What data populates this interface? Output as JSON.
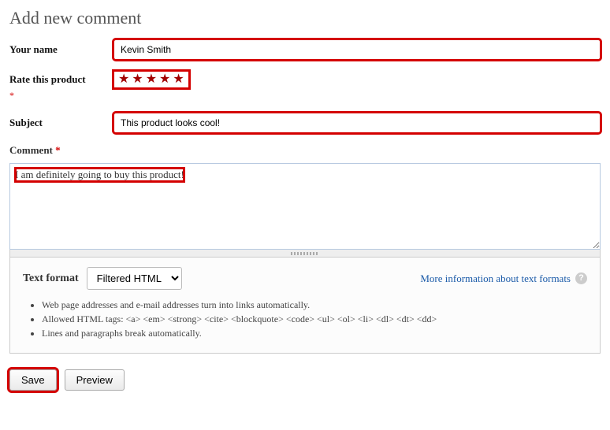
{
  "title": "Add new comment",
  "labels": {
    "your_name": "Your name",
    "rate": "Rate this product",
    "subject": "Subject",
    "comment": "Comment",
    "text_format": "Text format",
    "required": "*"
  },
  "fields": {
    "your_name": "Kevin Smith",
    "subject": "This product looks cool!",
    "comment": "I am definitely going to buy this product!",
    "rating": 5,
    "format_selected": "Filtered HTML"
  },
  "format_link": "More information about text formats",
  "tips": [
    "Web page addresses and e-mail addresses turn into links automatically.",
    "Allowed HTML tags: <a> <em> <strong> <cite> <blockquote> <code> <ul> <ol> <li> <dl> <dt> <dd>",
    "Lines and paragraphs break automatically."
  ],
  "buttons": {
    "save": "Save",
    "preview": "Preview"
  },
  "help_icon_char": "?"
}
